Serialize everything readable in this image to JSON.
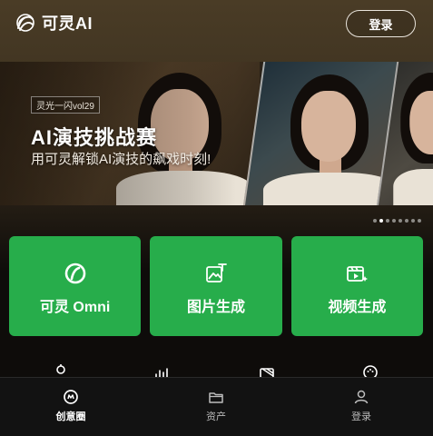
{
  "app": {
    "logo_text": "可灵AI"
  },
  "header": {
    "login_label": "登录"
  },
  "banner": {
    "tag": "灵光一闪vol29",
    "title": "AI演技挑战赛",
    "subtitle": "用可灵解锁AI演技的飙戏时刻!",
    "dots_total": 8,
    "active_dot": 1
  },
  "cards": [
    {
      "label": "可灵 Omni",
      "icon": "omni-icon"
    },
    {
      "label": "图片生成",
      "icon": "image-generate-icon"
    },
    {
      "label": "视频生成",
      "icon": "video-generate-icon"
    }
  ],
  "secondary_icons": [
    "figure-icon",
    "sound-wave-icon",
    "magic-wand-icon",
    "face-icon"
  ],
  "bottom_nav": [
    {
      "label": "创意圈",
      "icon": "creative-icon",
      "active": true
    },
    {
      "label": "资产",
      "icon": "folder-icon",
      "active": false
    },
    {
      "label": "登录",
      "icon": "user-icon",
      "active": false
    }
  ],
  "colors": {
    "accent_green": "#27ad4b",
    "header_brown": "#4a3c26",
    "background": "#0e0c0a"
  }
}
